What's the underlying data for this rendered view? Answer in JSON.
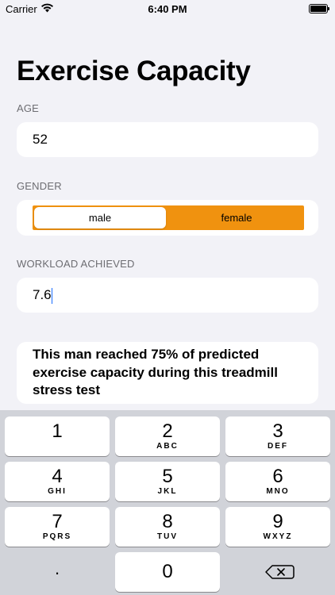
{
  "status": {
    "carrier": "Carrier",
    "time": "6:40 PM",
    "wifi_icon": "wifi-icon",
    "battery_icon": "battery-icon"
  },
  "title": "Exercise Capacity",
  "age": {
    "label": "AGE",
    "value": "52"
  },
  "gender": {
    "label": "GENDER",
    "options": [
      "male",
      "female"
    ],
    "selected": "male",
    "accent": "#f0920f"
  },
  "workload": {
    "label": "WORKLOAD ACHIEVED",
    "value": "7.6"
  },
  "result": "This man reached 75% of predicted exercise capacity during this treadmill stress test",
  "keyboard": {
    "keys": [
      {
        "num": "1",
        "letters": ""
      },
      {
        "num": "2",
        "letters": "ABC"
      },
      {
        "num": "3",
        "letters": "DEF"
      },
      {
        "num": "4",
        "letters": "GHI"
      },
      {
        "num": "5",
        "letters": "JKL"
      },
      {
        "num": "6",
        "letters": "MNO"
      },
      {
        "num": "7",
        "letters": "PQRS"
      },
      {
        "num": "8",
        "letters": "TUV"
      },
      {
        "num": "9",
        "letters": "WXYZ"
      },
      {
        "num": ".",
        "letters": ""
      },
      {
        "num": "0",
        "letters": ""
      }
    ],
    "delete_icon": "backspace-icon"
  }
}
